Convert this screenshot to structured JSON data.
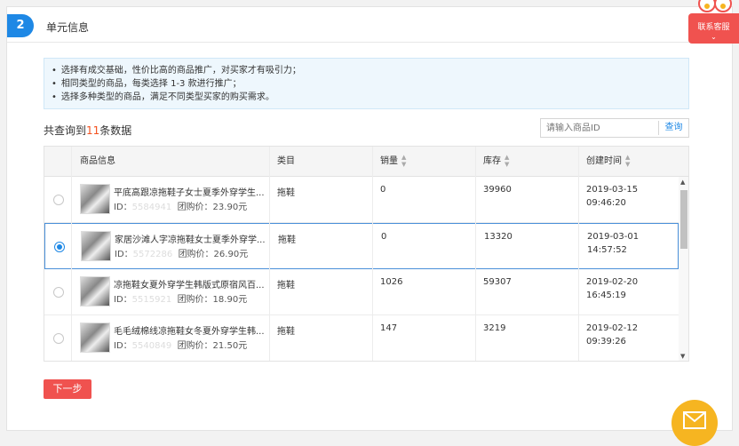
{
  "section": {
    "step": "2",
    "title": "单元信息"
  },
  "tips": [
    "选择有成交基础，性价比高的商品推广，对买家才有吸引力；",
    "相同类型的商品，每类选择 1-3 款进行推广；",
    "选择多种类型的商品，满足不同类型买家的购买需求。"
  ],
  "result": {
    "prefix": "共查询到",
    "count": "11",
    "suffix": "条数据"
  },
  "search": {
    "placeholder": "请输入商品ID",
    "button": "查询"
  },
  "table": {
    "headers": {
      "product": "商品信息",
      "category": "类目",
      "sales": "销量",
      "stock": "库存",
      "created": "创建时间"
    },
    "rows": [
      {
        "name": "平底高跟凉拖鞋子女士夏季外穿学生...",
        "id_label": "ID：",
        "id_value": "5584941",
        "price": "团购价：23.90元",
        "category": "拖鞋",
        "sales": "0",
        "stock": "39960",
        "date": "2019-03-15",
        "time": "09:46:20",
        "selected": false
      },
      {
        "name": "家居沙滩人字凉拖鞋女士夏季外穿学...",
        "id_label": "ID：",
        "id_value": "5572286",
        "price": "团购价：26.90元",
        "category": "拖鞋",
        "sales": "0",
        "stock": "13320",
        "date": "2019-03-01",
        "time": "14:57:52",
        "selected": true
      },
      {
        "name": "凉拖鞋女夏外穿学生韩版式原宿风百...",
        "id_label": "ID：",
        "id_value": "5515921",
        "price": "团购价：18.90元",
        "category": "拖鞋",
        "sales": "1026",
        "stock": "59307",
        "date": "2019-02-20",
        "time": "16:45:19",
        "selected": false
      },
      {
        "name": "毛毛绒棉线凉拖鞋女冬夏外穿学生韩...",
        "id_label": "ID：",
        "id_value": "5540849",
        "price": "团购价：21.50元",
        "category": "拖鞋",
        "sales": "147",
        "stock": "3219",
        "date": "2019-02-12",
        "time": "09:39:26",
        "selected": false
      }
    ]
  },
  "next_button": "下一步",
  "service_button": "联系客服",
  "icons": {
    "mail": "mail-icon",
    "sort": "sort-icon"
  },
  "colors": {
    "accent": "#1e88e5",
    "danger": "#f0524f",
    "highlight": "#f4511e",
    "mail": "#f6b521"
  }
}
